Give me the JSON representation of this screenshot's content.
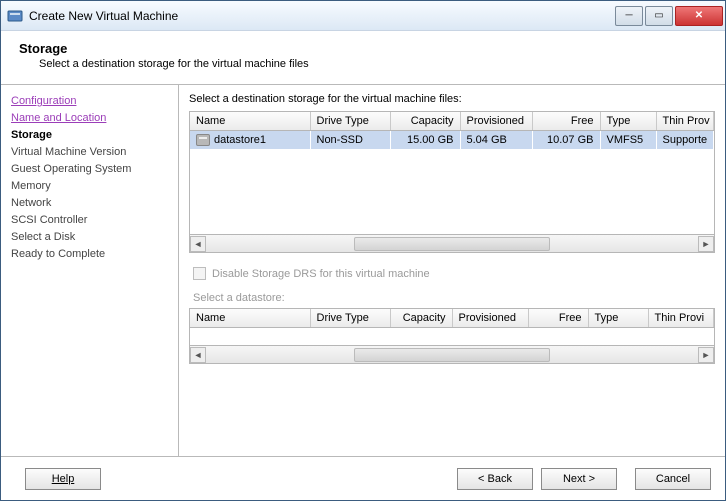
{
  "titlebar": {
    "title": "Create New Virtual Machine"
  },
  "header": {
    "title": "Storage",
    "subtitle": "Select a destination storage for the virtual machine files"
  },
  "sidebar": {
    "items": [
      {
        "label": "Configuration",
        "state": "done"
      },
      {
        "label": "Name and Location",
        "state": "done"
      },
      {
        "label": "Storage",
        "state": "current"
      },
      {
        "label": "Virtual Machine Version",
        "state": "pending"
      },
      {
        "label": "Guest Operating System",
        "state": "pending"
      },
      {
        "label": "Memory",
        "state": "pending"
      },
      {
        "label": "Network",
        "state": "pending"
      },
      {
        "label": "SCSI Controller",
        "state": "pending"
      },
      {
        "label": "Select a Disk",
        "state": "pending"
      },
      {
        "label": "Ready to Complete",
        "state": "pending"
      }
    ]
  },
  "main": {
    "instruction": "Select a destination storage for the virtual machine files:",
    "columns": {
      "name": "Name",
      "drive_type": "Drive Type",
      "capacity": "Capacity",
      "provisioned": "Provisioned",
      "free": "Free",
      "type": "Type",
      "thin": "Thin Prov"
    },
    "rows": [
      {
        "name": "datastore1",
        "drive_type": "Non-SSD",
        "capacity": "15.00 GB",
        "provisioned": "5.04 GB",
        "free": "10.07 GB",
        "type": "VMFS5",
        "thin": "Supporte"
      }
    ],
    "drs_checkbox_label": "Disable Storage DRS for this virtual machine",
    "subselect_label": "Select a datastore:",
    "columns2": {
      "name": "Name",
      "drive_type": "Drive Type",
      "capacity": "Capacity",
      "provisioned": "Provisioned",
      "free": "Free",
      "type": "Type",
      "thin": "Thin Provi"
    }
  },
  "footer": {
    "help": "Help",
    "back": "< Back",
    "next": "Next >",
    "cancel": "Cancel"
  }
}
